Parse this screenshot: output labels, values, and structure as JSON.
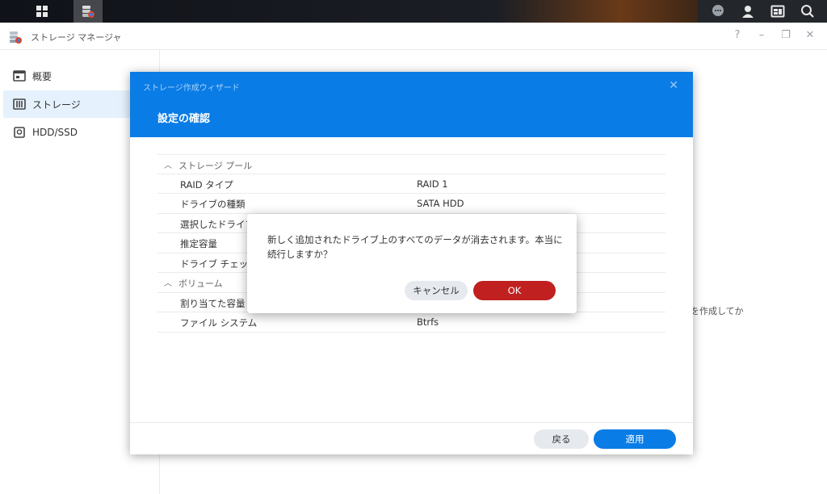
{
  "app": {
    "title": "ストレージ マネージャ"
  },
  "window_controls": {
    "help": "?",
    "minimize": "–",
    "restore": "❐",
    "close": "✕"
  },
  "sidebar": {
    "items": [
      {
        "label": "概要",
        "icon": "overview-icon"
      },
      {
        "label": "ストレージ",
        "icon": "storage-icon",
        "active": true
      },
      {
        "label": "HDD/SSD",
        "icon": "disk-icon"
      }
    ]
  },
  "background_hint": "を作成してか",
  "wizard": {
    "header": "ストレージ作成ウィザード",
    "title": "設定の確認",
    "close": "✕",
    "sections": [
      {
        "label": "ストレージ プール",
        "rows": [
          {
            "key": "RAID タイプ",
            "value": "RAID 1"
          },
          {
            "key": "ドライブの種類",
            "value": "SATA HDD"
          },
          {
            "key": "選択したドライブ",
            "value": ""
          },
          {
            "key": "推定容量",
            "value": ""
          },
          {
            "key": "ドライブ チェック",
            "value": ""
          }
        ]
      },
      {
        "label": "ボリューム",
        "rows": [
          {
            "key": "割り当てた容量",
            "value": ""
          },
          {
            "key": "ファイル システム",
            "value": "Btrfs"
          }
        ]
      }
    ],
    "back_label": "戻る",
    "apply_label": "適用"
  },
  "confirm": {
    "message": "新しく追加されたドライブ上のすべてのデータが消去されます。本当に続行しますか？",
    "cancel_label": "キャンセル",
    "ok_label": "OK"
  },
  "colors": {
    "accent": "#0a7ce6",
    "danger": "#c0201f",
    "sidebar_active": "#e5f1fc"
  }
}
